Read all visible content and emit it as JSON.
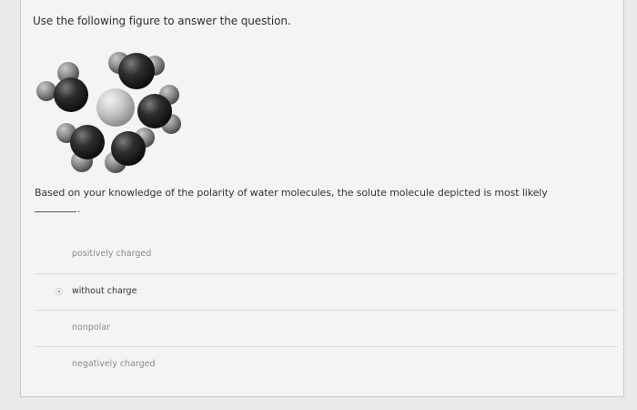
{
  "question": {
    "instruction": "Use the following figure to answer the question.",
    "prompt": "Based on your knowledge of the polarity of water molecules, the solute molecule depicted is most likely",
    "blank_suffix": "."
  },
  "options": [
    {
      "label": "positively charged",
      "selected": false
    },
    {
      "label": "without charge",
      "selected": true
    },
    {
      "label": "nonpolar",
      "selected": false
    },
    {
      "label": "negatively charged",
      "selected": false
    }
  ],
  "colors": {
    "background": "#eaeaea",
    "card": "#f4f4f4",
    "water_oxygen": "#2b2b2b",
    "water_hydrogen": "#8c8c8c",
    "solute": "#bdbdbd"
  }
}
